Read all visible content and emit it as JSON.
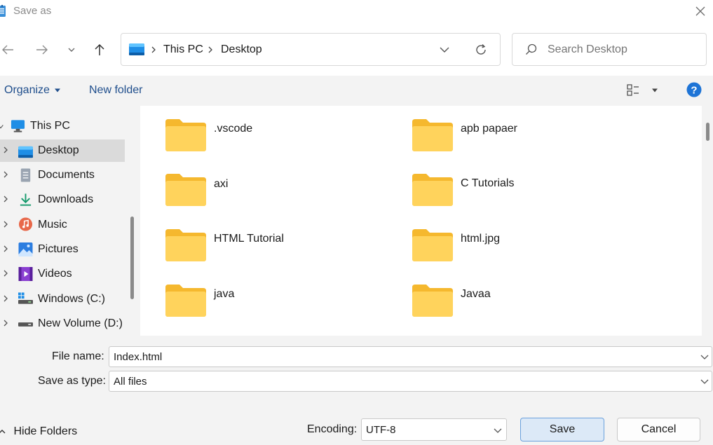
{
  "window": {
    "title": "Save as"
  },
  "address": {
    "segments": [
      "This PC",
      "Desktop"
    ]
  },
  "search": {
    "placeholder": "Search Desktop"
  },
  "commands": {
    "organize": "Organize",
    "new_folder": "New folder"
  },
  "sidebar": {
    "items": [
      {
        "label": "This PC",
        "icon": "monitor-icon",
        "expanded": true
      },
      {
        "label": "Desktop",
        "icon": "desktop-icon",
        "selected": true
      },
      {
        "label": "Documents",
        "icon": "documents-icon"
      },
      {
        "label": "Downloads",
        "icon": "download-icon"
      },
      {
        "label": "Music",
        "icon": "music-icon"
      },
      {
        "label": "Pictures",
        "icon": "pictures-icon"
      },
      {
        "label": "Videos",
        "icon": "videos-icon"
      },
      {
        "label": "Windows (C:)",
        "icon": "drive-windows-icon"
      },
      {
        "label": "New Volume (D:)",
        "icon": "drive-icon"
      }
    ]
  },
  "files": [
    {
      "name": ".vscode"
    },
    {
      "name": "apb papaer"
    },
    {
      "name": "axi"
    },
    {
      "name": "C Tutorials"
    },
    {
      "name": "HTML Tutorial"
    },
    {
      "name": "html.jpg"
    },
    {
      "name": "java"
    },
    {
      "name": "Javaa"
    }
  ],
  "form": {
    "file_name_label": "File name:",
    "file_name_value": "Index.html",
    "type_label": "Save as type:",
    "type_value": "All files",
    "encoding_label": "Encoding:",
    "encoding_value": "UTF-8",
    "hide_folders": "Hide Folders",
    "save": "Save",
    "cancel": "Cancel"
  },
  "colors": {
    "accent": "#0067c0",
    "folder": "#ffd35c",
    "help": "#1e74d6"
  }
}
